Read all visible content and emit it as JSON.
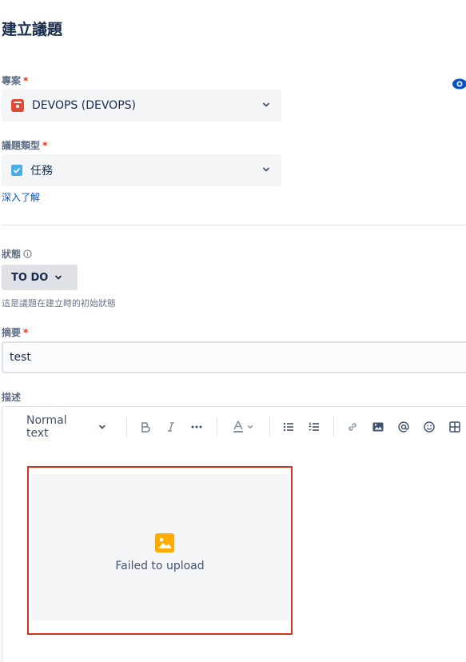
{
  "page_title": "建立議題",
  "project": {
    "label": "專案",
    "value": "DEVOPS (DEVOPS)",
    "icon": "project-icon"
  },
  "issue_type": {
    "label": "議題類型",
    "value": "任務",
    "icon": "task-checkbox-icon",
    "learn_more": "深入了解"
  },
  "status": {
    "label": "狀態",
    "value": "TO DO",
    "helper": "這是議題在建立時的初始狀態"
  },
  "summary": {
    "label": "摘要",
    "value": "test"
  },
  "description": {
    "label": "描述",
    "toolbar": {
      "text_style": "Normal text"
    },
    "upload": {
      "message": "Failed to upload"
    }
  },
  "required_marker": "*",
  "colors": {
    "required": "#de350b",
    "link": "#0052cc",
    "accent_red": "#d0341c"
  }
}
